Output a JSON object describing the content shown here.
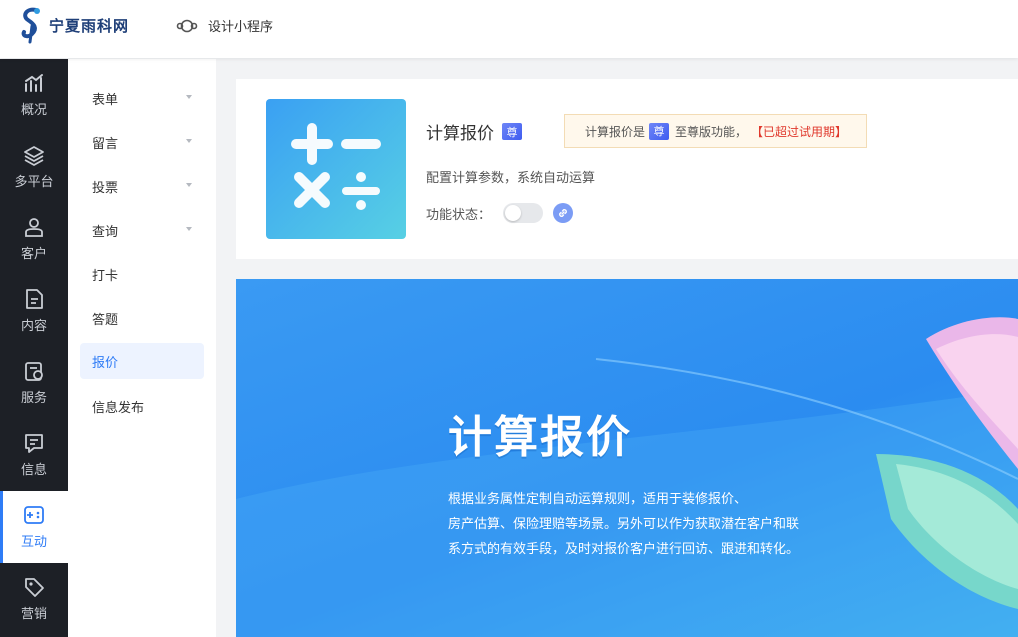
{
  "topbar": {
    "logo_text": "宁夏雨科网",
    "mini_program_label": "设计小程序"
  },
  "leftnav": {
    "items": [
      {
        "label": "概况",
        "icon": "chart-icon"
      },
      {
        "label": "多平台",
        "icon": "layers-icon"
      },
      {
        "label": "客户",
        "icon": "user-icon"
      },
      {
        "label": "内容",
        "icon": "document-icon"
      },
      {
        "label": "服务",
        "icon": "service-icon"
      },
      {
        "label": "信息",
        "icon": "message-icon"
      },
      {
        "label": "互动",
        "icon": "gamepad-icon",
        "active": true
      },
      {
        "label": "营销",
        "icon": "tag-icon"
      }
    ]
  },
  "submenu": {
    "items": [
      {
        "label": "表单",
        "has_caret": true
      },
      {
        "label": "留言",
        "has_caret": true
      },
      {
        "label": "投票",
        "has_caret": true
      },
      {
        "label": "查询",
        "has_caret": true
      },
      {
        "label": "打卡",
        "has_caret": false
      },
      {
        "label": "答题",
        "has_caret": false
      },
      {
        "label": "报价",
        "has_caret": false,
        "active": true
      },
      {
        "label": "信息发布",
        "has_caret": false
      }
    ]
  },
  "feature": {
    "title": "计算报价",
    "badge": "尊",
    "notice_prefix": "计算报价是",
    "notice_badge": "尊",
    "notice_suffix": "至尊版功能，",
    "notice_warning": "【已超过试用期】",
    "description": "配置计算参数，系统自动运算",
    "status_label": "功能状态：",
    "status_enabled": false
  },
  "banner": {
    "title": "计算报价",
    "desc_lines": [
      "根据业务属性定制自动运算规则，适用于装修报价、",
      "房产估算、保险理赔等场景。另外可以作为获取潜在客户和联",
      "系方式的有效手段，及时对报价客户进行回访、跟进和转化。"
    ]
  },
  "colors": {
    "accent": "#2f7cf6",
    "nav_bg": "#1d2026",
    "warning": "#e0382c"
  }
}
